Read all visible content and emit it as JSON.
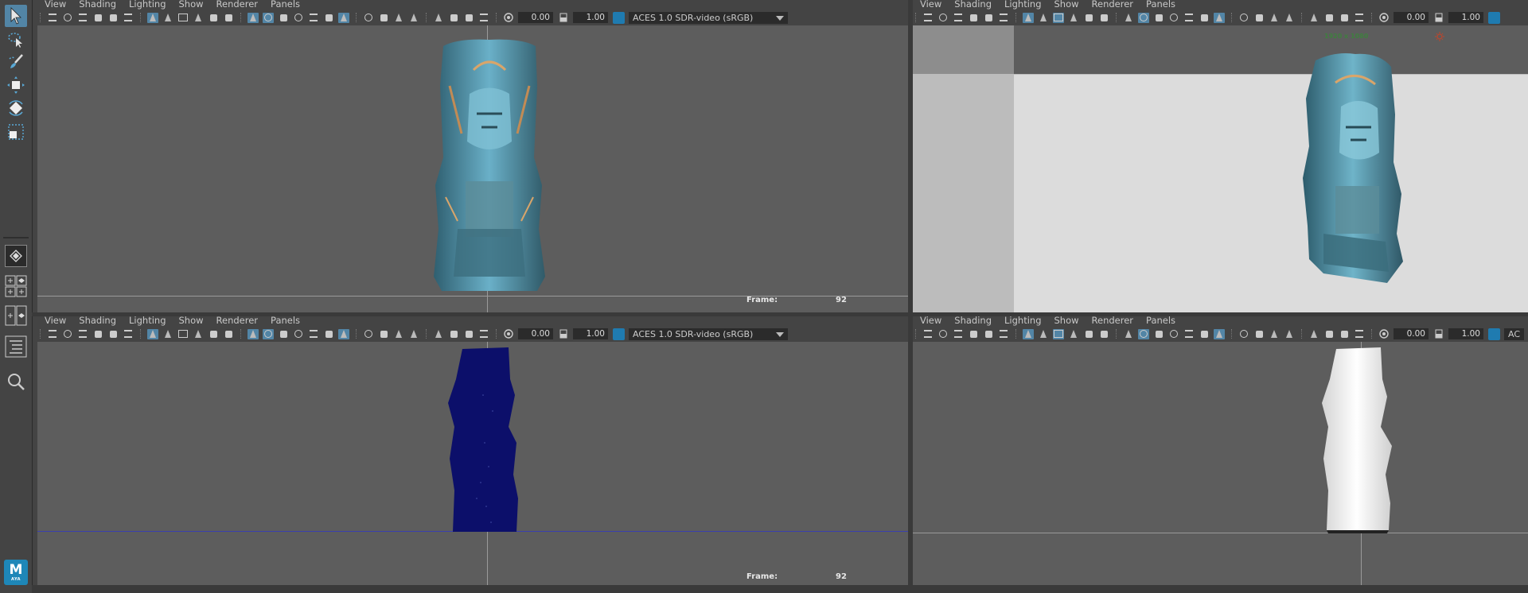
{
  "menus": [
    "View",
    "Shading",
    "Lighting",
    "Show",
    "Renderer",
    "Panels"
  ],
  "panel_toolbar": {
    "gamma": "0.00",
    "exposure": "1.00",
    "color_space": "ACES 1.0 SDR-video (sRGB)",
    "color_space_short": "AC",
    "color_space_icon": "colorspace-icon"
  },
  "panels": {
    "top_left": {
      "frame_label": "Frame:",
      "frame_value": "92"
    },
    "top_right": {
      "resolution_gate": "1920 x 1080"
    },
    "bottom_left": {
      "frame_label": "Frame:",
      "frame_value": "92"
    },
    "bottom_right": {}
  },
  "toolbox": {
    "tools": [
      "select-tool-icon",
      "lasso-tool-icon",
      "paint-select-tool-icon",
      "move-tool-icon",
      "rotate-tool-icon",
      "scale-tool-icon"
    ],
    "layouts": [
      "single-perspective-icon",
      "four-view-icon",
      "two-view-icon",
      "outliner-icon",
      "search-icon"
    ],
    "logo": {
      "letter": "M",
      "sub": "AYA"
    }
  },
  "colors": {
    "accent": "#5285a6",
    "viewport_bg": "#5d5d5d",
    "panel_bg": "#444444",
    "statue_teal": "#4a8ea6",
    "points_blue": "#0c0f6a",
    "resolution_text": "#3f7f3f"
  }
}
